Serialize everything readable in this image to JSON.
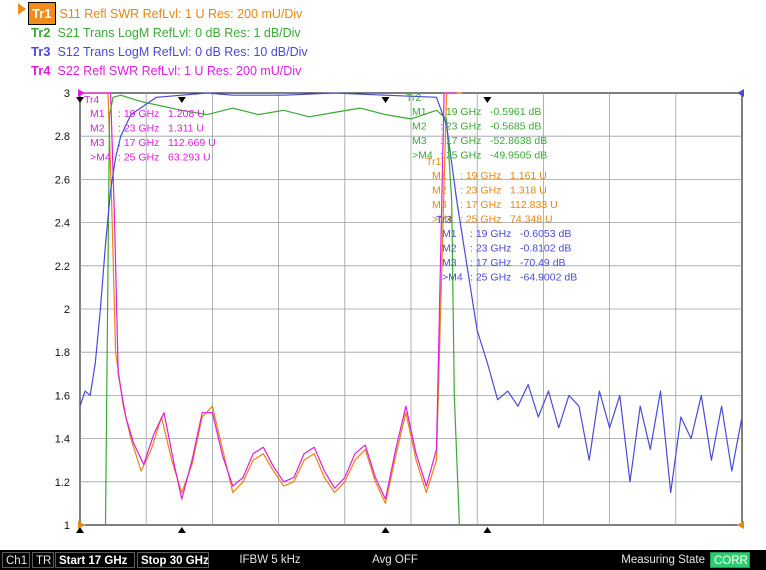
{
  "traces": [
    {
      "id": "Tr1",
      "desc": "S11 Refl SWR RefLvl: 1  U Res: 200 mU/Div",
      "color": "#e8860f",
      "active": true
    },
    {
      "id": "Tr2",
      "desc": "S21 Trans LogM RefLvl: 0  dB Res: 1  dB/Div",
      "color": "#3aaa35"
    },
    {
      "id": "Tr3",
      "desc": "S12 Trans LogM RefLvl: 0  dB Res: 10  dB/Div",
      "color": "#4a4ad8"
    },
    {
      "id": "Tr4",
      "desc": "S22 Refl SWR RefLvl: 1  U Res: 200 mU/Div",
      "color": "#e01ce0"
    }
  ],
  "marker_tables": [
    {
      "label": "Tr4",
      "color": "#e01ce0",
      "rows": [
        {
          "marker": "M1",
          "freq": "19 GHz",
          "value": "1.208  U"
        },
        {
          "marker": "M2",
          "freq": "23 GHz",
          "value": "1.311  U"
        },
        {
          "marker": "M3",
          "freq": "17 GHz",
          "value": "112.669  U"
        },
        {
          "marker": ">M4",
          "freq": "25 GHz",
          "value": "63.293  U"
        }
      ]
    },
    {
      "label": "Tr2",
      "color": "#3aaa35",
      "rows": [
        {
          "marker": "M1",
          "freq": "19 GHz",
          "value": "-0.5961  dB"
        },
        {
          "marker": "M2",
          "freq": "23 GHz",
          "value": "-0.5685  dB"
        },
        {
          "marker": "M3",
          "freq": "17 GHz",
          "value": "-52.8638  dB"
        },
        {
          "marker": ">M4",
          "freq": "25 GHz",
          "value": "-49.9505  dB"
        }
      ]
    },
    {
      "label": "Tr1",
      "color": "#e8860f",
      "rows": [
        {
          "marker": "M1",
          "freq": "19 GHz",
          "value": "1.161  U"
        },
        {
          "marker": "M2",
          "freq": "23 GHz",
          "value": "1.318  U"
        },
        {
          "marker": "M3",
          "freq": "17 GHz",
          "value": "112.833  U"
        },
        {
          "marker": ">M4",
          "freq": "25 GHz",
          "value": "74.348  U"
        }
      ]
    },
    {
      "label": "Tr3",
      "color": "#4a4ad8",
      "rows": [
        {
          "marker": "M1",
          "freq": "19 GHz",
          "value": "-0.6053  dB"
        },
        {
          "marker": "M2",
          "freq": "23 GHz",
          "value": "-0.8102  dB"
        },
        {
          "marker": "M3",
          "freq": "17 GHz",
          "value": "-70.49  dB"
        },
        {
          "marker": ">M4",
          "freq": "25 GHz",
          "value": "-64.9002  dB"
        }
      ]
    }
  ],
  "status_bar": {
    "channel": "Ch1",
    "tr": "TR",
    "start": "Start 17 GHz",
    "stop": "Stop 30 GHz",
    "ifbw": "IFBW 5 kHz",
    "avg": "Avg OFF",
    "state": "Measuring State",
    "corr": "CORR"
  },
  "chart_data": {
    "type": "line",
    "x_unit": "GHz",
    "xlim": [
      17,
      30
    ],
    "ylim": [
      1,
      3
    ],
    "yticks": [
      "1",
      "1.2",
      "1.4",
      "1.6",
      "1.8",
      "2",
      "2.2",
      "2.4",
      "2.6",
      "2.8",
      "3"
    ],
    "grid": true,
    "x_divisions": 10,
    "marker_freqs": {
      "M1": 19,
      "M2": 23,
      "M3": 17,
      "M4": 25
    },
    "series": [
      {
        "name": "Tr1",
        "color": "#e8860f",
        "x": [
          17,
          17.2,
          17.4,
          17.55,
          17.62,
          17.7,
          17.85,
          18,
          18.2,
          18.4,
          18.6,
          18.8,
          19,
          19.2,
          19.4,
          19.6,
          19.8,
          20,
          20.2,
          20.4,
          20.6,
          20.8,
          21,
          21.2,
          21.4,
          21.6,
          21.8,
          22,
          22.2,
          22.4,
          22.6,
          22.8,
          23,
          23.2,
          23.4,
          23.6,
          23.8,
          24,
          24.2,
          24.5
        ],
        "y": [
          3,
          3,
          3,
          3,
          2.5,
          1.8,
          1.55,
          1.4,
          1.25,
          1.35,
          1.5,
          1.3,
          1.15,
          1.28,
          1.5,
          1.55,
          1.35,
          1.15,
          1.2,
          1.3,
          1.33,
          1.25,
          1.18,
          1.2,
          1.3,
          1.33,
          1.22,
          1.15,
          1.2,
          1.3,
          1.35,
          1.2,
          1.1,
          1.32,
          1.52,
          1.3,
          1.15,
          1.3,
          3,
          3
        ]
      },
      {
        "name": "Tr4",
        "color": "#e01ce0",
        "x": [
          17,
          17.2,
          17.4,
          17.6,
          17.68,
          17.75,
          17.9,
          18.05,
          18.25,
          18.45,
          18.65,
          18.85,
          19,
          19.2,
          19.4,
          19.6,
          19.8,
          20,
          20.2,
          20.4,
          20.6,
          20.8,
          21,
          21.2,
          21.4,
          21.6,
          21.8,
          22,
          22.2,
          22.4,
          22.6,
          22.8,
          23,
          23.2,
          23.4,
          23.6,
          23.8,
          24,
          24.15,
          24.4
        ],
        "y": [
          3,
          3,
          3,
          3,
          2.4,
          1.7,
          1.5,
          1.38,
          1.28,
          1.42,
          1.52,
          1.28,
          1.12,
          1.3,
          1.52,
          1.52,
          1.32,
          1.18,
          1.22,
          1.33,
          1.36,
          1.27,
          1.2,
          1.22,
          1.33,
          1.36,
          1.25,
          1.17,
          1.22,
          1.33,
          1.37,
          1.22,
          1.12,
          1.35,
          1.55,
          1.33,
          1.18,
          1.35,
          3,
          3
        ]
      },
      {
        "name": "Tr2",
        "color": "#3aaa35",
        "x": [
          17.5,
          17.55,
          17.58,
          17.65,
          17.8,
          18.2,
          18.6,
          19,
          19.5,
          20,
          20.5,
          21,
          21.5,
          22,
          22.5,
          23,
          23.5,
          24,
          24.2,
          24.3,
          24.35,
          24.45
        ],
        "y": [
          1,
          2.2,
          2.9,
          2.98,
          2.99,
          2.96,
          2.94,
          2.92,
          2.9,
          2.93,
          2.9,
          2.92,
          2.89,
          2.91,
          2.93,
          2.9,
          2.88,
          2.92,
          2.88,
          2.5,
          1.6,
          1
        ]
      },
      {
        "name": "Tr3",
        "color": "#4a4ad8",
        "x": [
          17,
          17.1,
          17.2,
          17.3,
          17.4,
          17.5,
          17.6,
          17.7,
          17.8,
          17.9,
          18,
          18.5,
          19,
          19.5,
          20,
          21,
          22,
          23,
          24,
          24.2,
          24.4,
          24.6,
          24.8,
          25,
          25.2,
          25.4,
          25.6,
          25.8,
          26,
          26.2,
          26.4,
          26.6,
          26.8,
          27,
          27.2,
          27.4,
          27.6,
          27.8,
          28,
          28.2,
          28.4,
          28.6,
          28.8,
          29,
          29.2,
          29.4,
          29.6,
          29.8,
          30
        ],
        "y": [
          1.55,
          1.62,
          1.6,
          1.75,
          2,
          2.3,
          2.55,
          2.7,
          2.8,
          2.85,
          2.9,
          2.98,
          2.99,
          3,
          2.99,
          2.99,
          3,
          2.99,
          2.98,
          2.85,
          2.5,
          2.2,
          1.9,
          1.75,
          1.58,
          1.62,
          1.55,
          1.65,
          1.5,
          1.62,
          1.45,
          1.6,
          1.55,
          1.3,
          1.62,
          1.45,
          1.6,
          1.2,
          1.55,
          1.35,
          1.62,
          1.15,
          1.5,
          1.4,
          1.6,
          1.3,
          1.55,
          1.25,
          1.5
        ]
      }
    ]
  }
}
